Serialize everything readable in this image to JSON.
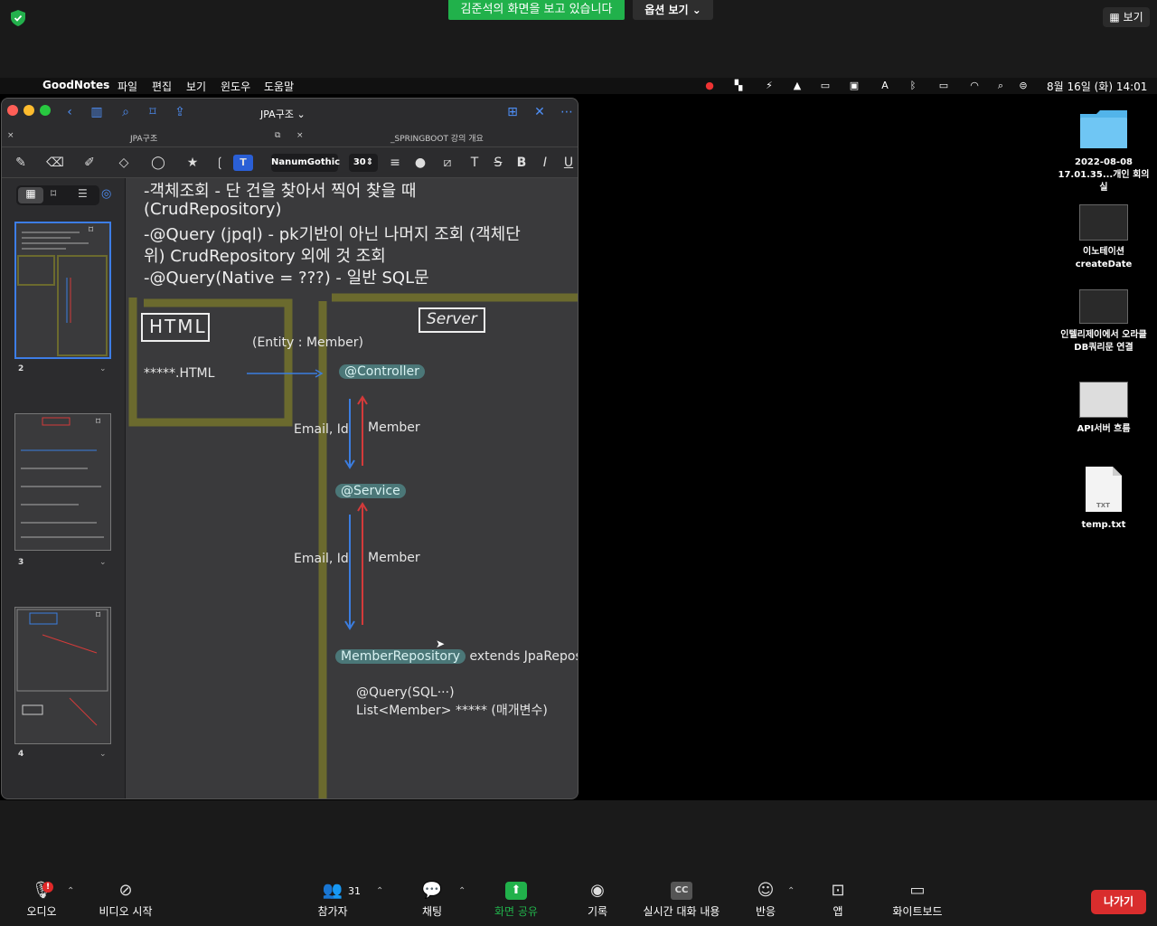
{
  "zoom_top": {
    "share_banner": "김준석의 화면을 보고 있습니다",
    "option_label": "옵션 보기",
    "view_label": "보기"
  },
  "menubar": {
    "app_name": "GoodNotes",
    "items": [
      "파일",
      "편집",
      "보기",
      "윈도우",
      "도움말"
    ],
    "datetime": "8월 16일 (화)  14:01"
  },
  "desktop": {
    "items": [
      {
        "label": "2022-08-08\n17.01.35...개인 회의실",
        "icon": "folder-icon"
      },
      {
        "label": "이노테이션\ncreateDate",
        "icon": "screenshot-icon"
      },
      {
        "label": "인텔리제이에서 오라클\nDB쿼리문 연결",
        "icon": "screenshot-icon"
      },
      {
        "label": "API서버 흐름",
        "icon": "screenshot-icon"
      },
      {
        "label": "temp.txt",
        "icon": "txt-file-icon"
      }
    ]
  },
  "goodnotes": {
    "title": "JPA구조",
    "tabs": [
      "JPA구조",
      "_SPRINGBOOT 강의 개요"
    ],
    "font_name": "NanumGothic",
    "font_size": "30",
    "pages": [
      "2",
      "3",
      "4"
    ],
    "notes": {
      "line1": "-객체조회 - 단 건을 찾아서 찍어 찾을 때",
      "line2": "(CrudRepository)",
      "line3": "-@Query (jpql) - pk기반이 아닌 나머지 조회 (객체단",
      "line4": "위) CrudRepository 외에 것 조회",
      "line5": "-@Query(Native = ???) - 일반 SQL문",
      "html_box": "HTML",
      "server_box": "Server",
      "entity_label": "(Entity : Member)",
      "html_file": "*****.HTML",
      "controller": "@Controller",
      "email_id_1": "Email, Id",
      "member_1": "Member",
      "service": "@Service",
      "email_id_2": "Email, Id",
      "member_2": "Member",
      "repository": "MemberRepository",
      "extends": "extends JpaReposito",
      "query_line": "@Query(SQL···)",
      "list_line": "List<Member> ***** (매개변수)"
    }
  },
  "zoom_bottom": {
    "audio": "오디오",
    "video": "비디오 시작",
    "participants": "참가자",
    "participant_count": "31",
    "chat": "채팅",
    "share": "화면 공유",
    "record": "기록",
    "captions": "실시간 대화 내용",
    "reactions": "반응",
    "apps": "앱",
    "whiteboard": "화이트보드",
    "leave": "나가기"
  },
  "colors": {
    "share_green": "#21b14b",
    "leave_red": "#d92d2d",
    "highlight": "#5aaaaa",
    "olive": "#6b6a2e",
    "arrow_blue": "#3b7de0",
    "arrow_red": "#d43a3a"
  }
}
